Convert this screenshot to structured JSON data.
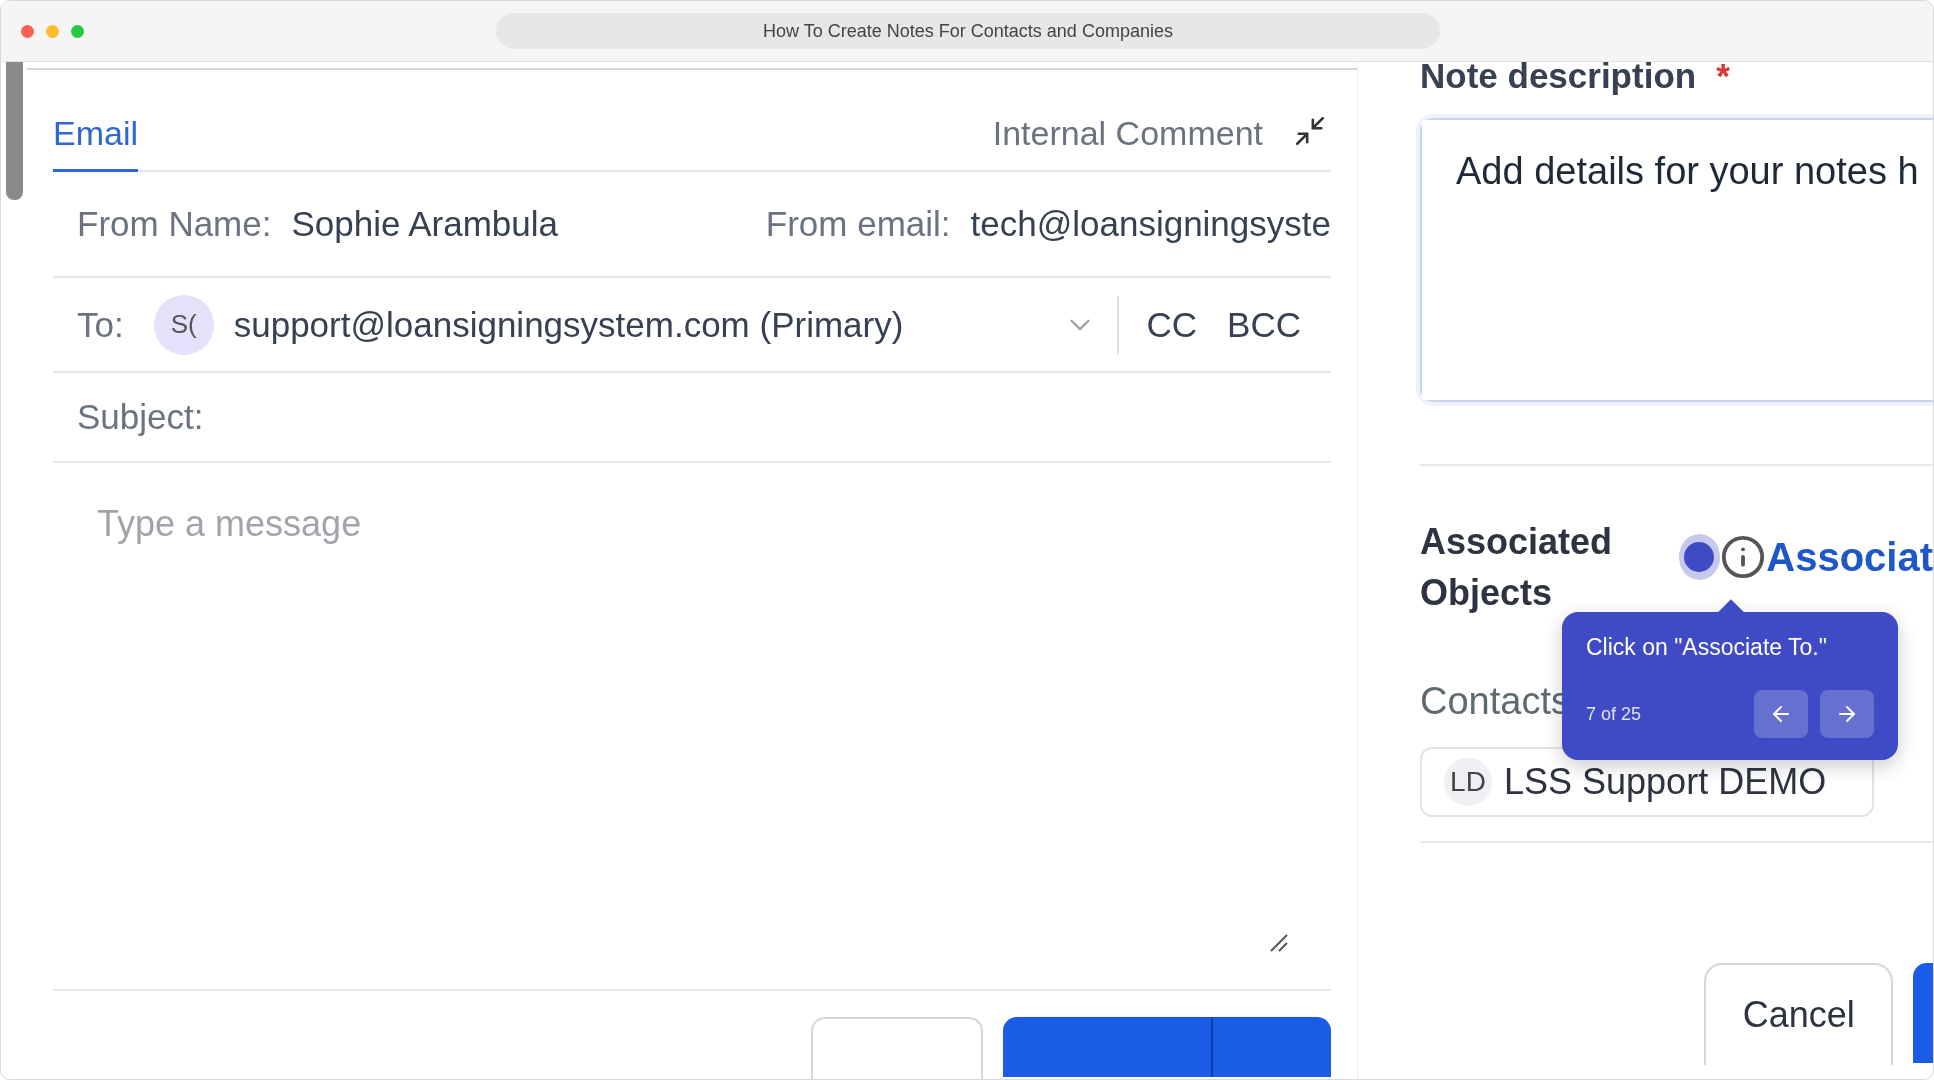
{
  "window": {
    "title": "How To Create Notes For Contacts and Companies"
  },
  "email_panel": {
    "tabs": [
      {
        "label": "Email",
        "selected": true
      },
      {
        "label": "Internal Comment",
        "selected": false
      }
    ],
    "from_name": {
      "label": "From Name:",
      "value": "Sophie Arambula"
    },
    "from_email": {
      "label": "From email:",
      "value": "tech@loansigningsyste"
    },
    "to": {
      "label": "To:",
      "avatar": "S(",
      "value": "support@loansigningsystem.com (Primary)"
    },
    "copy_options": [
      "CC",
      "BCC"
    ],
    "subject": {
      "label": "Subject:"
    },
    "message": {
      "placeholder": "Type a message"
    }
  },
  "note_panel": {
    "description_label": "Note description",
    "required_mark": "*",
    "description": {
      "placeholder": "Add details for your notes h"
    },
    "associated_label": "Associated Objects",
    "associate_link": "Associat",
    "contacts_label": "Contacts",
    "contacts": [
      {
        "initials": "LD",
        "name": "LSS Support DEMO"
      }
    ],
    "cancel": "Cancel"
  },
  "tour_tooltip": {
    "text": "Click on \"Associate To.\"",
    "progress": "7 of 25"
  }
}
